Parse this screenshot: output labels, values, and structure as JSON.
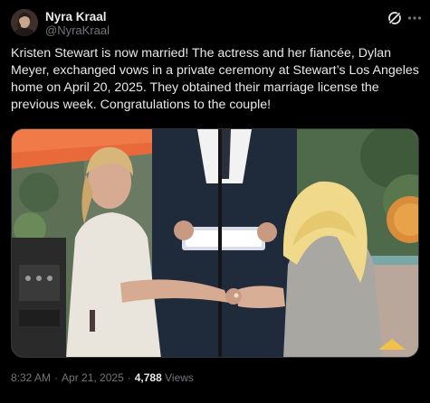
{
  "author": {
    "display_name": "Nyra Kraal",
    "handle": "@NyraKraal"
  },
  "icons": {
    "grok": "grok-slash-icon",
    "more": "more-horizontal-icon"
  },
  "tweet": {
    "text": "Kristen Stewart is now married! The actress and her fiancée, Dylan Meyer, exchanged vows in a private ceremony at Stewart’s Los Angeles home on April 20, 2025. They obtained their marriage license the previous week. Congratulations to the couple!",
    "media_alt": "wedding-ring-exchange-photo"
  },
  "meta": {
    "time": "8:32 AM",
    "dot": "·",
    "date": "Apr 21, 2025",
    "views_count": "4,788",
    "views_label": "Views"
  },
  "colors": {
    "background": "#000000",
    "text_primary": "#e7e9ea",
    "text_secondary": "#71767b",
    "border": "#2f3336"
  }
}
